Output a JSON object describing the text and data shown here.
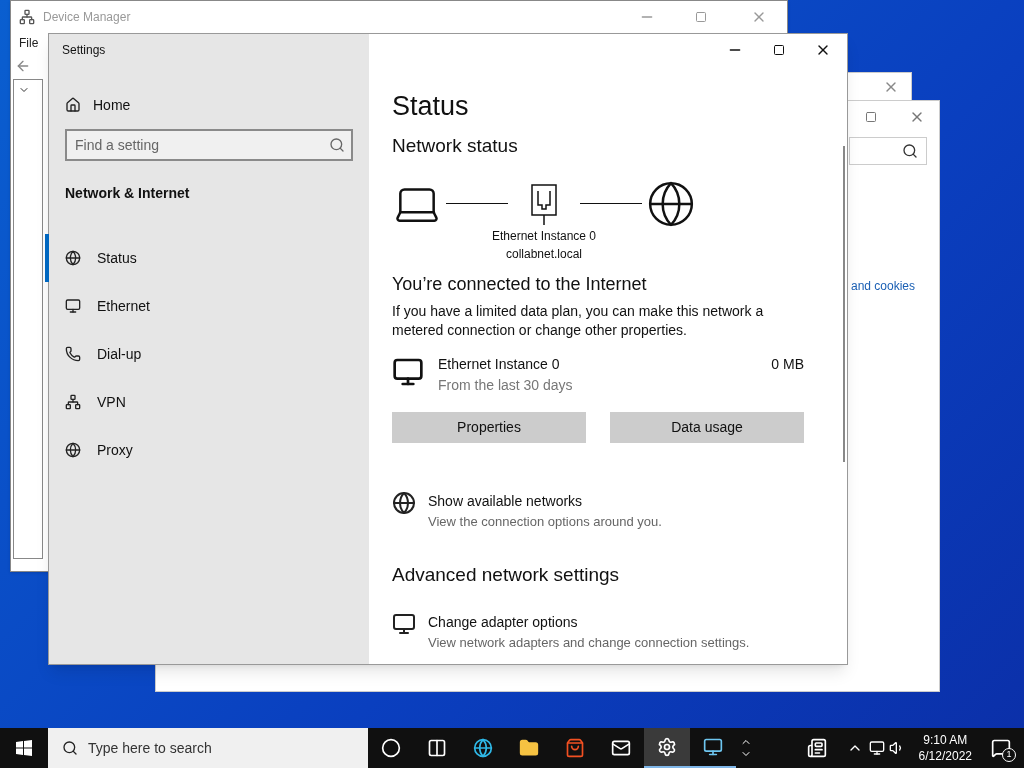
{
  "device_manager": {
    "title": "Device Manager",
    "menu": [
      "File"
    ]
  },
  "back_window": {
    "link": "and cookies"
  },
  "settings": {
    "title": "Settings",
    "home": "Home",
    "search": {
      "placeholder": "Find a setting"
    },
    "section": "Network & Internet",
    "nav": [
      {
        "label": "Status",
        "kind": "status",
        "selected": true
      },
      {
        "label": "Ethernet",
        "kind": "ethernet",
        "selected": false
      },
      {
        "label": "Dial-up",
        "kind": "dialup",
        "selected": false
      },
      {
        "label": "VPN",
        "kind": "vpn",
        "selected": false
      },
      {
        "label": "Proxy",
        "kind": "proxy",
        "selected": false
      }
    ],
    "heading": "Status",
    "network_status": "Network status",
    "adapter": "Ethernet Instance 0",
    "domain": "collabnet.local",
    "connected": "You’re connected to the Internet",
    "description": "If you have a limited data plan, you can make this network a metered connection or change other properties.",
    "usage": {
      "name": "Ethernet Instance 0",
      "period": "From the last 30 days",
      "amount": "0 MB"
    },
    "buttons": [
      "Properties",
      "Data usage"
    ],
    "links": [
      {
        "title": "Show available networks",
        "subtitle": "View the connection options around you.",
        "kind": "networks"
      }
    ],
    "advanced": "Advanced network settings",
    "advanced_links": [
      {
        "title": "Change adapter options",
        "subtitle": "View network adapters and change connection settings.",
        "kind": "adapter"
      }
    ]
  },
  "taskbar": {
    "search_placeholder": "Type here to search",
    "apps": [
      {
        "kind": "cortana",
        "active": false
      },
      {
        "kind": "taskview",
        "active": false
      },
      {
        "kind": "edge",
        "active": false
      },
      {
        "kind": "explorer",
        "active": false
      },
      {
        "kind": "store",
        "active": false
      },
      {
        "kind": "mail",
        "active": false
      },
      {
        "kind": "settings",
        "active": true
      },
      {
        "kind": "sandbox",
        "active": true
      }
    ],
    "time": "9:10 AM",
    "date": "6/12/2022",
    "notifications": "1"
  }
}
